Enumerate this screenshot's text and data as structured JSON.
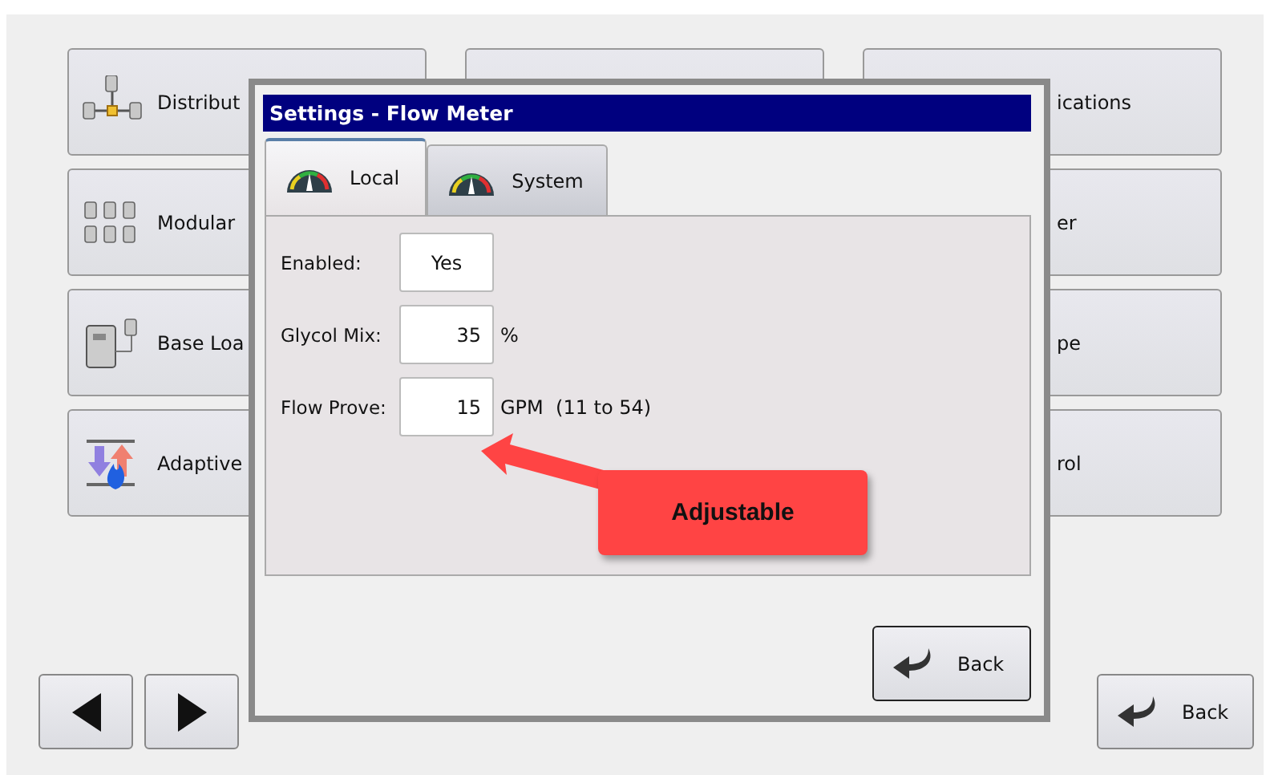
{
  "left_tiles": [
    {
      "label": "Distribut",
      "kind": "distribution"
    },
    {
      "label": "Modular",
      "kind": "modular"
    },
    {
      "label": "Base Loa",
      "kind": "base-load"
    },
    {
      "label": "Adaptive",
      "kind": "adaptive"
    }
  ],
  "right_tiles": [
    {
      "label": "ications"
    },
    {
      "label": "er"
    },
    {
      "label": "pe"
    },
    {
      "label": "rol"
    }
  ],
  "dialog": {
    "title": "Settings - Flow Meter",
    "tabs": [
      {
        "label": "Local",
        "selected": true
      },
      {
        "label": "System",
        "selected": false
      }
    ],
    "fields": [
      {
        "label": "Enabled:",
        "value": "Yes",
        "kind": "toggle"
      },
      {
        "label": "Glycol Mix:",
        "value": "35",
        "unit": "%",
        "kind": "number"
      },
      {
        "label": "Flow Prove:",
        "value": "15",
        "unit": "GPM  (11 to 54)",
        "kind": "number"
      }
    ],
    "back_button": "Back"
  },
  "callout": {
    "text": "Adjustable"
  },
  "back_button": "Back"
}
